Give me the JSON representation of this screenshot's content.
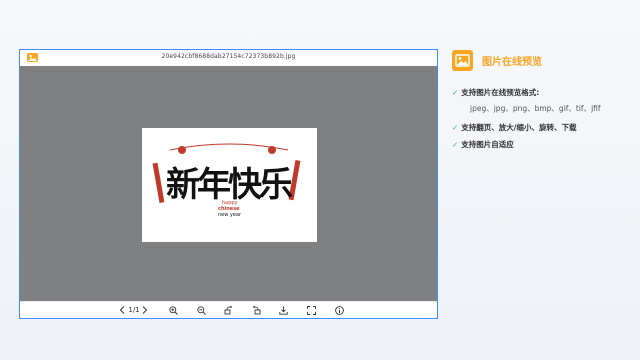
{
  "viewer": {
    "filename": "20e942cbf8688dab27154c72373b892b.jpg",
    "page_indicator": "1/1",
    "image_text": {
      "headline": "新年快乐",
      "line1": "happy",
      "line2": "chinese",
      "line3": "new year"
    },
    "toolbar": {
      "prev_icon": "chevron-left-icon",
      "next_icon": "chevron-right-icon",
      "zoom_in_icon": "zoom-in-icon",
      "zoom_out_icon": "zoom-out-icon",
      "rotate_left_icon": "rotate-left-icon",
      "rotate_right_icon": "rotate-right-icon",
      "download_icon": "download-icon",
      "fullscreen_icon": "fullscreen-icon",
      "info_icon": "info-icon"
    }
  },
  "panel": {
    "title": "图片在线预览",
    "features": [
      "支持图片在线预览格式:",
      "支持翻页、放大/缩小、旋转、下载",
      "支持图片自适应"
    ],
    "formats": "jpeg、jpg、png、bmp、gif、tif、jfif",
    "check_icon": "check-icon"
  },
  "colors": {
    "accent": "#f6a623",
    "check": "#2bb673",
    "border": "#3e8ef7",
    "stage": "#7f8081"
  }
}
